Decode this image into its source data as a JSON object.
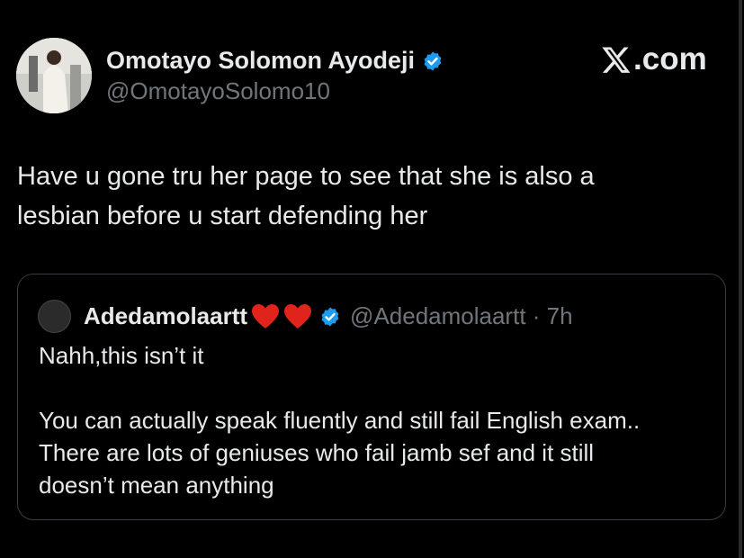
{
  "tweet": {
    "display_name": "Omotayo Solomon Ayodeji",
    "handle": "@OmotayoSolomo10",
    "text_line1": "Have u gone tru her page to see that she is also a",
    "text_line2": "lesbian before u start defending her"
  },
  "brand": {
    "label": ".com",
    "icon": "x-logo-icon"
  },
  "quoted_tweet": {
    "display_name": "Adedamolaartt",
    "emoji": [
      "red-heart",
      "red-heart"
    ],
    "handle_time": "@Adedamolaartt · 7h",
    "paragraph1": "Nahh,this isn’t it",
    "line1": "You can actually speak fluently and still fail English exam..",
    "line2": "There are lots of geniuses who fail jamb sef and it still",
    "line3": "doesn’t mean anything"
  },
  "colors": {
    "background": "#000000",
    "text": "#e7e9ea",
    "muted": "#71767b",
    "verified": "#1d9bf0",
    "heart": "#e0241b"
  }
}
